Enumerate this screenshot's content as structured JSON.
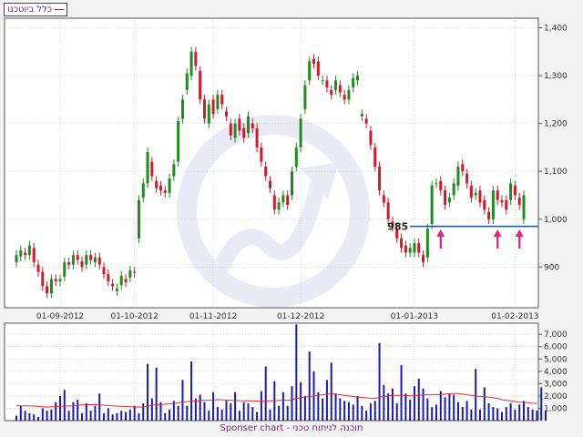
{
  "legend": {
    "label": "כלל ביוטכנו"
  },
  "footer": {
    "text": "תוכנה לניתוח טכני - Sponser chart"
  },
  "colors": {
    "up": "#1e8c1e",
    "down": "#d11a2a",
    "volume": "#1b1bb0",
    "volume_ma": "#e03030",
    "support": "#1f4e9b",
    "arrows": "#ee1e7a",
    "grid": "#b9b9b9",
    "frame": "#555555"
  },
  "chart_data": [
    {
      "type": "candlestick",
      "x_tick_labels": [
        "01-09-2012",
        "01-10-2012",
        "01-11-2012",
        "01-12-2012",
        "01-01-2013",
        "01-02-2013"
      ],
      "y_tick_labels": [
        "900",
        "1,000",
        "1,100",
        "1,200",
        "1,300",
        "1,400"
      ],
      "ylim": [
        815,
        1420
      ],
      "grid": true,
      "candles": [
        [
          910,
          925
        ],
        [
          922,
          935
        ],
        [
          930,
          925
        ],
        [
          925,
          945
        ],
        [
          940,
          910
        ],
        [
          905,
          890
        ],
        [
          890,
          860
        ],
        [
          860,
          845
        ],
        [
          845,
          875
        ],
        [
          875,
          870
        ],
        [
          870,
          875
        ],
        [
          880,
          910
        ],
        [
          910,
          905
        ],
        [
          905,
          925
        ],
        [
          925,
          915
        ],
        [
          912,
          900
        ],
        [
          905,
          925
        ],
        [
          925,
          915
        ],
        [
          910,
          920
        ],
        [
          920,
          905
        ],
        [
          900,
          885
        ],
        [
          885,
          870
        ],
        [
          865,
          860
        ],
        [
          850,
          855
        ],
        [
          862,
          882
        ],
        [
          875,
          868
        ],
        [
          878,
          893
        ],
        [
          890,
          888
        ],
        [
          960,
          1040
        ],
        [
          1045,
          1075
        ],
        [
          1075,
          1140
        ],
        [
          1120,
          1090
        ],
        [
          1080,
          1065
        ],
        [
          1070,
          1060
        ],
        [
          1060,
          1055
        ],
        [
          1055,
          1085
        ],
        [
          1090,
          1115
        ],
        [
          1120,
          1205
        ],
        [
          1210,
          1250
        ],
        [
          1270,
          1305
        ],
        [
          1300,
          1350
        ],
        [
          1350,
          1320
        ],
        [
          1310,
          1250
        ],
        [
          1250,
          1210
        ],
        [
          1200,
          1240
        ],
        [
          1250,
          1220
        ],
        [
          1230,
          1260
        ],
        [
          1260,
          1240
        ],
        [
          1225,
          1215
        ],
        [
          1200,
          1175
        ],
        [
          1170,
          1200
        ],
        [
          1210,
          1185
        ],
        [
          1190,
          1170
        ],
        [
          1180,
          1215
        ],
        [
          1200,
          1190
        ],
        [
          1190,
          1150
        ],
        [
          1150,
          1120
        ],
        [
          1110,
          1090
        ],
        [
          1080,
          1065
        ],
        [
          1050,
          1020
        ],
        [
          1020,
          1035
        ],
        [
          1035,
          1050
        ],
        [
          1050,
          1030
        ],
        [
          1050,
          1100
        ],
        [
          1110,
          1150
        ],
        [
          1150,
          1210
        ],
        [
          1230,
          1280
        ],
        [
          1290,
          1330
        ],
        [
          1335,
          1325
        ],
        [
          1330,
          1300
        ],
        [
          1290,
          1290
        ],
        [
          1290,
          1275
        ],
        [
          1270,
          1260
        ],
        [
          1270,
          1290
        ],
        [
          1280,
          1265
        ],
        [
          1260,
          1250
        ],
        [
          1250,
          1270
        ],
        [
          1275,
          1295
        ],
        [
          1290,
          1300
        ],
        [
          1215,
          1220
        ],
        [
          1210,
          1200
        ],
        [
          1185,
          1155
        ],
        [
          1150,
          1110
        ],
        [
          1110,
          1060
        ],
        [
          1050,
          1035
        ],
        [
          1035,
          1000
        ],
        [
          995,
          985
        ],
        [
          980,
          960
        ],
        [
          960,
          940
        ],
        [
          945,
          930
        ],
        [
          930,
          940
        ],
        [
          930,
          950
        ],
        [
          950,
          930
        ],
        [
          925,
          910
        ],
        [
          920,
          980
        ],
        [
          990,
          1070
        ],
        [
          1075,
          1075
        ],
        [
          1080,
          1060
        ],
        [
          1060,
          1030
        ],
        [
          1035,
          1045
        ],
        [
          1050,
          1075
        ],
        [
          1070,
          1110
        ],
        [
          1115,
          1100
        ],
        [
          1095,
          1075
        ],
        [
          1070,
          1045
        ],
        [
          1050,
          1055
        ],
        [
          1060,
          1035
        ],
        [
          1040,
          1020
        ],
        [
          1015,
          1000
        ],
        [
          1000,
          1060
        ],
        [
          1060,
          1040
        ],
        [
          1040,
          1035
        ],
        [
          1040,
          1020
        ],
        [
          1040,
          1075
        ],
        [
          1070,
          1050
        ],
        [
          1045,
          1030
        ],
        [
          1000,
          1050
        ]
      ],
      "horizontal_line": {
        "value": 985,
        "label": "985"
      },
      "arrow_positions": [
        97,
        110,
        115
      ]
    },
    {
      "type": "bar",
      "series": [
        {
          "values": [
            400,
            1200,
            800,
            600,
            500,
            300,
            1000,
            800,
            900,
            1500,
            2000,
            2500,
            800,
            1500,
            1700,
            600,
            1400,
            800,
            1200,
            2200,
            600,
            1000,
            500,
            600,
            800,
            700,
            900,
            1200,
            600,
            1400,
            4600,
            1800,
            4300,
            1500,
            600,
            900,
            1600,
            1200,
            3300,
            1200,
            4800,
            1800,
            2100,
            1500,
            800,
            2300,
            1100,
            900,
            1600,
            1400,
            2300,
            800,
            1500,
            1400,
            1100,
            700,
            2400,
            4400,
            900,
            3200,
            1200,
            2300,
            1200,
            2800,
            7800,
            3100,
            2000,
            5600,
            4000,
            2300,
            1800,
            3300,
            4700,
            2200,
            1800,
            1600,
            1500,
            1300,
            2000,
            1200,
            800,
            1400,
            1600,
            6300,
            2900,
            2200,
            2600,
            1400,
            4500,
            2200,
            1700,
            2800,
            3400,
            2600,
            1800,
            1100,
            1300,
            2400,
            1900,
            2200,
            2100,
            1500,
            1100,
            1600,
            900,
            4200,
            900,
            2700,
            1400,
            1100,
            1000,
            700,
            1100,
            1400,
            900,
            1300,
            1600,
            1100,
            900,
            800,
            2700,
            800
          ]
        }
      ],
      "moving_average": [
        1200,
        1200,
        1210,
        1190,
        1180,
        1150,
        1120,
        1100,
        1120,
        1120,
        1160,
        1180,
        1180,
        1200,
        1250,
        1280,
        1300,
        1290,
        1300,
        1270,
        1250,
        1230,
        1200,
        1180,
        1170,
        1150,
        1130,
        1120,
        1100,
        1100,
        1160,
        1250,
        1290,
        1300,
        1330,
        1360,
        1400,
        1430,
        1510,
        1540,
        1570,
        1590,
        1620,
        1650,
        1660,
        1680,
        1700,
        1690,
        1660,
        1640,
        1640,
        1620,
        1610,
        1620,
        1600,
        1590,
        1580,
        1590,
        1610,
        1620,
        1630,
        1640,
        1650,
        1700,
        1800,
        1850,
        1910,
        1950,
        2000,
        2050,
        2100,
        2150,
        2200,
        2150,
        2100,
        2050,
        2000,
        1950,
        1900,
        1880,
        1850,
        1800,
        1800,
        1900,
        1950,
        2000,
        2050,
        2050,
        2050,
        2050,
        2000,
        2020,
        2050,
        2080,
        2100,
        2100,
        2110,
        2120,
        2150,
        2180,
        2200,
        2200,
        2150,
        2100,
        2050,
        2000,
        1950,
        1950,
        1900,
        1850,
        1800,
        1700,
        1650,
        1600,
        1550,
        1500,
        1500,
        1450,
        1400,
        1400
      ],
      "y_tick_labels": [
        "1,000",
        "2,000",
        "3,000",
        "4,000",
        "5,000",
        "6,000",
        "7,000"
      ],
      "ylim": [
        0,
        7900
      ]
    }
  ]
}
